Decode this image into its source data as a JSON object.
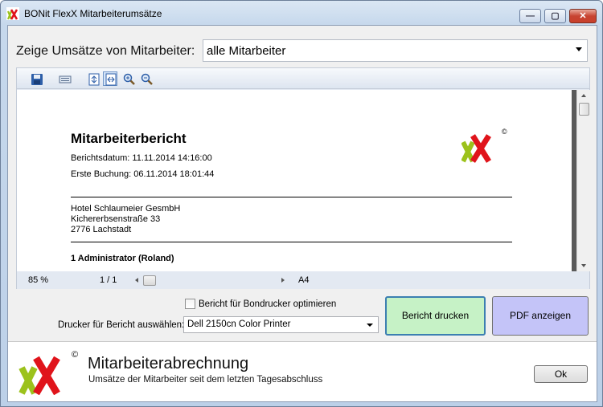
{
  "window": {
    "title": "BONit FlexX Mitarbeiterumsätze",
    "minimize_glyph": "—",
    "maximize_glyph": "▢",
    "close_glyph": "✕"
  },
  "filter": {
    "label": "Zeige Umsätze von Mitarbeiter:",
    "selected": "alle Mitarbeiter"
  },
  "viewer": {
    "toolbar_icons": [
      "save-icon",
      "print-layout-icon",
      "fit-page-icon",
      "fit-width-icon",
      "zoom-in-icon",
      "zoom-out-icon"
    ],
    "zoom": "85 %",
    "page": "1 / 1",
    "paper": "A4"
  },
  "report": {
    "title": "Mitarbeiterbericht",
    "date_line": "Berichtsdatum:  11.11.2014   14:16:00",
    "first_booking_line": "Erste  Buchung:  06.11.2014  18:01:44",
    "company": "Hotel  Schlaumeier   GesmbH",
    "street": "Kichererbsenstraße  33",
    "city": "2776  Lachstadt",
    "employee": "1 Administrator (Roland)",
    "logo_mark": "©"
  },
  "options": {
    "optimize_label": "Bericht für Bondrucker optimieren",
    "optimize_checked": false,
    "printer_label": "Drucker für Bericht auswählen:",
    "printer_selected": "Dell 2150cn Color Printer",
    "print_button": "Bericht drucken",
    "pdf_button": "PDF anzeigen"
  },
  "footer": {
    "title": "Mitarbeiterabrechnung",
    "subtitle": "Umsätze der Mitarbeiter seit dem letzten Tagesabschluss",
    "ok_button": "Ok",
    "logo_mark": "©"
  },
  "colors": {
    "logo_green": "#9cc21c",
    "logo_red": "#e0141b",
    "print_button_bg": "#c6f2c6",
    "pdf_button_bg": "#c4c4f8"
  }
}
